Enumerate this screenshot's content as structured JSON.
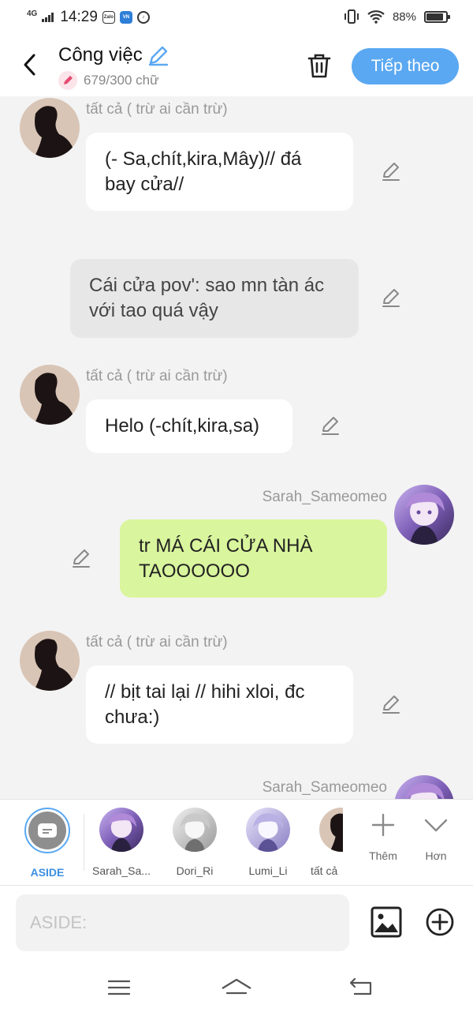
{
  "status_bar": {
    "network": "4G",
    "time": "14:29",
    "apps": [
      "Zalo",
      "VN",
      "TK"
    ],
    "battery_text": "88%",
    "battery_level": 0.88
  },
  "header": {
    "title": "Công việc",
    "word_count": "679/300 chữ",
    "next_label": "Tiếp theo"
  },
  "messages": [
    {
      "sender": "tất cả ( trừ ai cần trừ)",
      "text": "(- Sa,chít,kira,Mây)// đá bay cửa//"
    },
    {
      "sender": "",
      "text": "Cái cửa pov': sao mn tàn ác với tao quá vậy"
    },
    {
      "sender": "tất cả ( trừ ai cần trừ)",
      "text": "Helo (-chít,kira,sa)"
    },
    {
      "sender": "Sarah_Sameomeo",
      "text": "tr MÁ CÁI CỬA NHÀ TAOOOOOO"
    },
    {
      "sender": "tất cả ( trừ ai cần trừ)",
      "text": "// bịt tai lại // hihi xloi, đc chưa:)"
    },
    {
      "sender": "Sarah_Sameomeo",
      "text": ""
    }
  ],
  "characters": [
    {
      "label": "ASIDE"
    },
    {
      "label": "Sarah_Sa..."
    },
    {
      "label": "Dori_Ri"
    },
    {
      "label": "Lumi_Li"
    },
    {
      "label": "tất cả"
    }
  ],
  "tools": {
    "add_label": "Thêm",
    "more_label": "Hơn"
  },
  "input": {
    "placeholder": "ASIDE:"
  },
  "colors": {
    "accent": "#5aa8f2",
    "green_bubble": "#d9f59d",
    "chat_bg": "#f3f3f3"
  }
}
